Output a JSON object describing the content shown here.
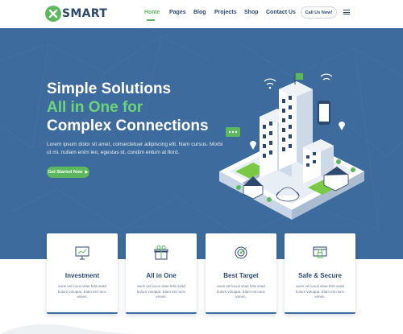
{
  "brand": {
    "name": "SMART",
    "logo_icon": "x-circle-logo",
    "color": "#5cb85c"
  },
  "nav": {
    "items": [
      {
        "label": "Home",
        "active": true
      },
      {
        "label": "Pages",
        "active": false
      },
      {
        "label": "Blog",
        "active": false
      },
      {
        "label": "Projects",
        "active": false
      },
      {
        "label": "Shop",
        "active": false
      },
      {
        "label": "Contact Us",
        "active": false
      }
    ],
    "call_label": "Call Us Now!",
    "menu_icon": "hamburger-menu-icon"
  },
  "hero": {
    "title_line1": "Simple Solutions",
    "title_line2": "All in One for",
    "title_line3": "Complex Connections",
    "description": "Lorem ipsum dolor sit amet, consectetuer adipiscing elit. Nam cursus. Morbi ut mi. nullam enim leo, egestas id, condim entum at flord.",
    "cta_label": "Get Started Now",
    "cta_icon": "chevron-right-icon",
    "background": "#3d6b9e",
    "accent": "#6ed47a"
  },
  "features": [
    {
      "title": "Investment",
      "icon": "presentation-chart-icon",
      "text": "aurie vel locus vitae felis sead bulum volutpat. Elam est nunc venen."
    },
    {
      "title": "All in One",
      "icon": "gift-box-icon",
      "text": "aurie vel locus vitae felis sead bulum volutpat. Elam est nunc venen."
    },
    {
      "title": "Best Target",
      "icon": "target-icon",
      "text": "aurie vel locus vitae felis sead bulum volutpat. Elam est nunc venen."
    },
    {
      "title": "Safe & Secure",
      "icon": "secure-lock-icon",
      "text": "aurie vel locus vitae felis sead bulum volutpat. Elam est nunc venen."
    }
  ]
}
